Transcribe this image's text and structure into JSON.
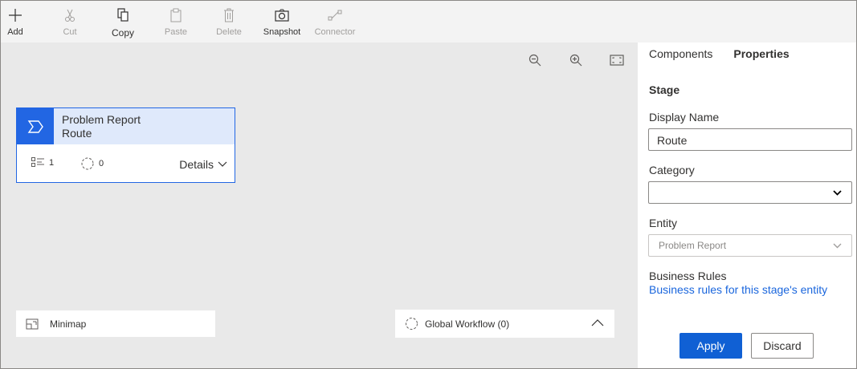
{
  "toolbar": {
    "items": [
      {
        "label": "Add",
        "icon": "plus-icon",
        "enabled": true
      },
      {
        "label": "Cut",
        "icon": "scissors-icon",
        "enabled": false
      },
      {
        "label": "Copy",
        "icon": "copy-icon",
        "enabled": true
      },
      {
        "label": "Paste",
        "icon": "clipboard-icon",
        "enabled": false
      },
      {
        "label": "Delete",
        "icon": "trash-icon",
        "enabled": false
      },
      {
        "label": "Snapshot",
        "icon": "camera-icon",
        "enabled": true
      },
      {
        "label": "Connector",
        "icon": "connector-icon",
        "enabled": false
      }
    ]
  },
  "canvas": {
    "zoom_controls": [
      "zoom-out-icon",
      "zoom-in-icon",
      "fit-to-screen-icon"
    ],
    "stage": {
      "title": "Problem Report",
      "subtitle": "Route",
      "steps_count": "1",
      "workflows_count": "0",
      "details_label": "Details"
    },
    "minimap_label": "Minimap",
    "global_workflow_label": "Global Workflow (0)"
  },
  "pane": {
    "tabs": [
      {
        "label": "Components",
        "active": false
      },
      {
        "label": "Properties",
        "active": true
      }
    ],
    "section_title": "Stage",
    "display_name": {
      "label": "Display Name",
      "value": "Route"
    },
    "category": {
      "label": "Category",
      "value": ""
    },
    "entity": {
      "label": "Entity",
      "value": "Problem Report"
    },
    "business_rules": {
      "label": "Business Rules",
      "link": "Business rules for this stage's entity"
    },
    "apply_label": "Apply",
    "discard_label": "Discard"
  },
  "colors": {
    "accent": "#2266e3",
    "stage_header": "#dfe9fb",
    "link": "#1a66dd",
    "canvas_bg": "#e9e9e9"
  }
}
